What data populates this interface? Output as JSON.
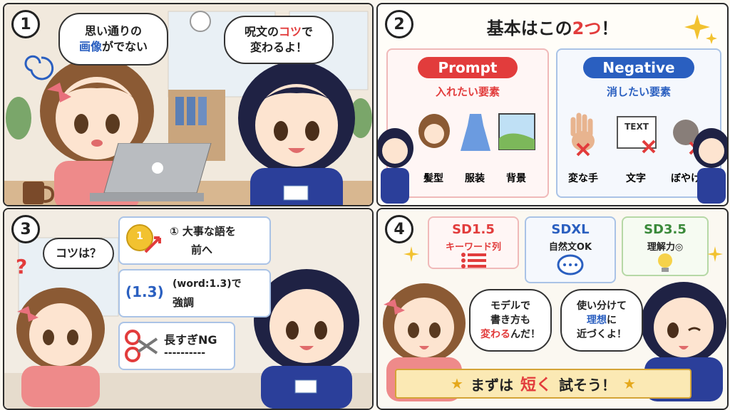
{
  "panel1": {
    "number": "1",
    "left_bubble": {
      "line1": "思い通りの",
      "line2_a": "画像",
      "line2_b": "がでない"
    },
    "right_bubble": {
      "line1_a": "呪文の",
      "line1_b": "コツ",
      "line1_c": "で",
      "line2": "変わるよ！"
    }
  },
  "panel2": {
    "number": "2",
    "title_a": "基本はこの",
    "title_b": "2つ",
    "title_c": "！",
    "prompt": {
      "label": "Prompt",
      "sub": "入れたい要素",
      "items": [
        "髪型",
        "服装",
        "背景"
      ]
    },
    "negative": {
      "label": "Negative",
      "sub": "消したい要素",
      "items": [
        "変な手",
        "文字",
        "ぼやけ"
      ],
      "text_icon": "TEXT"
    }
  },
  "panel3": {
    "number": "3",
    "bubble": "コツは？",
    "question_mark": "?",
    "tips": [
      {
        "medal": "1",
        "line1": "① 大事な語を",
        "line2": "前へ"
      },
      {
        "tag": "(1.3)",
        "line1": "(word:1.3)で",
        "line2": "強調"
      },
      {
        "line1": "長すぎNG",
        "line2": "----------"
      }
    ]
  },
  "panel4": {
    "number": "4",
    "models": [
      {
        "name": "SD1.5",
        "desc": "キーワード列",
        "color": "#e23c3c"
      },
      {
        "name": "SDXL",
        "desc": "自然文OK",
        "color": "#2a5fc0"
      },
      {
        "name": "SD3.5",
        "desc": "理解力◎",
        "color": "#3a8a3a"
      }
    ],
    "bubble_left": {
      "line1": "モデルで",
      "line2": "書き方も",
      "line3_a": "変わる",
      "line3_b": "んだ！"
    },
    "bubble_right": {
      "line1": "使い分けて",
      "line2_a": "理想",
      "line2_b": "に",
      "line3": "近づくよ！"
    },
    "banner": {
      "a": "まずは",
      "b": "短く",
      "c": "試そう！"
    }
  }
}
